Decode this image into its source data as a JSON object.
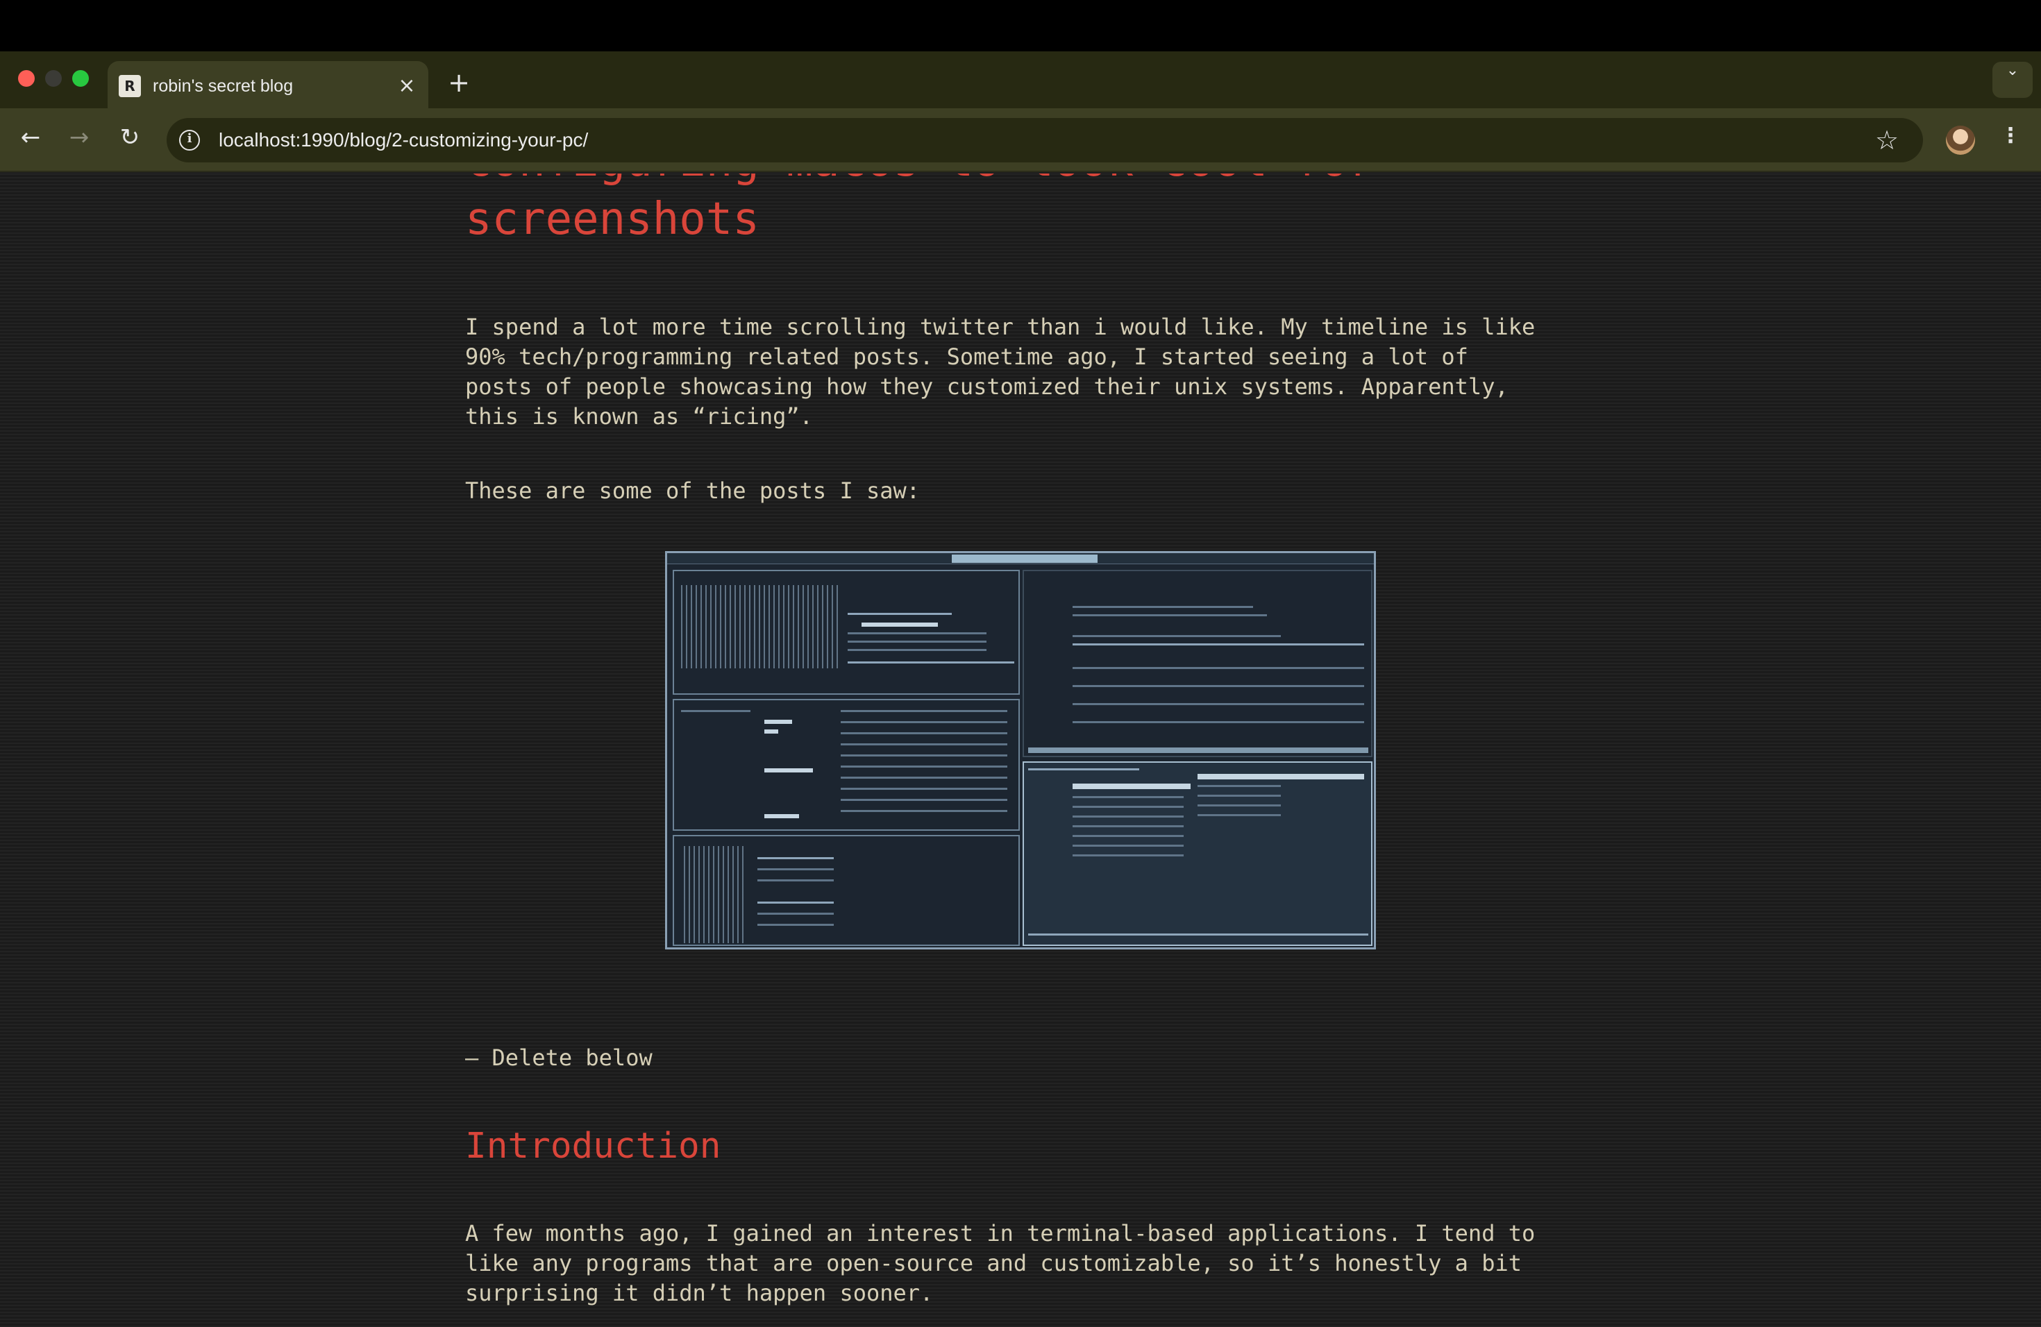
{
  "browser": {
    "tab_title": "robin's secret blog",
    "tab_close": "×",
    "new_tab": "+",
    "tab_search": "⌄",
    "favicon_letter": "R",
    "url": "localhost:1990/blog/2-customizing-your-pc/",
    "nav": {
      "back": "←",
      "forward": "→",
      "reload": "↻",
      "info": "i",
      "star": "☆",
      "menu": "⋮"
    }
  },
  "post": {
    "title": "configuring macos to look cool for screenshots",
    "paragraphs": [
      "I spend a lot more time scrolling twitter than i would like. My timeline is like 90% tech/programming related posts. Sometime ago, I started seeing a lot of posts of people showcasing how they customized their unix systems. Apparently, this is known as “ricing”.",
      "These are some of the posts I saw:",
      "— Delete below"
    ],
    "section_heading": "Introduction",
    "intro_paragraph": "A few months ago, I gained an interest in terminal-based applications. I tend to like any programs that are open-source and customizable, so it’s honestly a bit surprising it didn’t happen sooner."
  },
  "colors": {
    "accent": "#d9453a",
    "body_text": "#d6cfb6",
    "page_bg": "#1f1f1f",
    "toolbar_bg": "#3d3f23",
    "tabstrip_bg": "#272912"
  }
}
